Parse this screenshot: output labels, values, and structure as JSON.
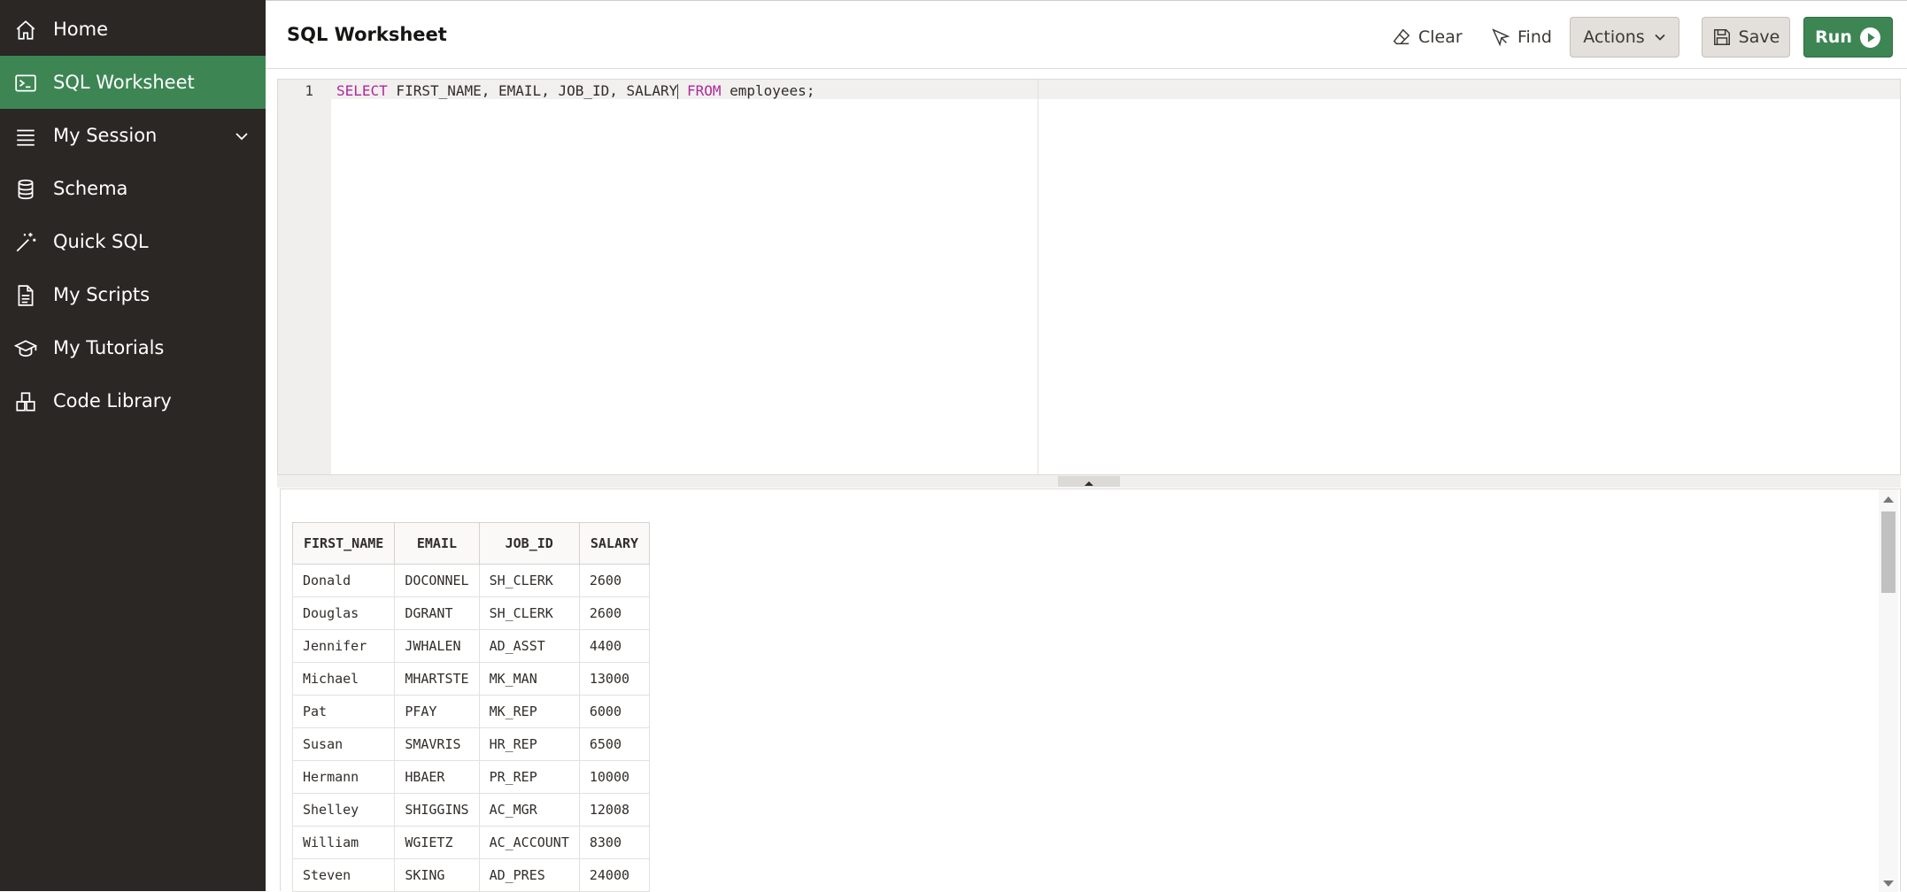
{
  "sidebar": {
    "items": [
      {
        "label": "Home",
        "icon": "home-icon"
      },
      {
        "label": "SQL Worksheet",
        "icon": "terminal-icon",
        "active": true
      },
      {
        "label": "My Session",
        "icon": "list-icon",
        "expandable": true
      },
      {
        "label": "Schema",
        "icon": "database-icon"
      },
      {
        "label": "Quick SQL",
        "icon": "magic-wand-icon"
      },
      {
        "label": "My Scripts",
        "icon": "document-icon"
      },
      {
        "label": "My Tutorials",
        "icon": "graduation-cap-icon"
      },
      {
        "label": "Code Library",
        "icon": "blocks-icon"
      }
    ],
    "active_color": "#3d8654",
    "background": "#2a2724"
  },
  "header": {
    "title": "SQL Worksheet",
    "toolbar": {
      "clear_label": "Clear",
      "find_label": "Find",
      "actions_label": "Actions",
      "save_label": "Save",
      "run_label": "Run"
    }
  },
  "editor": {
    "line_number": "1",
    "tokens": {
      "select_kw": "SELECT",
      "columns": " FIRST_NAME, EMAIL, JOB_ID, SALARY",
      "from_kw": "FROM",
      "rest": " employees;"
    },
    "keyword_color": "#b0289c"
  },
  "results": {
    "columns": [
      "FIRST_NAME",
      "EMAIL",
      "JOB_ID",
      "SALARY"
    ],
    "rows": [
      [
        "Donald",
        "DOCONNEL",
        "SH_CLERK",
        "2600"
      ],
      [
        "Douglas",
        "DGRANT",
        "SH_CLERK",
        "2600"
      ],
      [
        "Jennifer",
        "JWHALEN",
        "AD_ASST",
        "4400"
      ],
      [
        "Michael",
        "MHARTSTE",
        "MK_MAN",
        "13000"
      ],
      [
        "Pat",
        "PFAY",
        "MK_REP",
        "6000"
      ],
      [
        "Susan",
        "SMAVRIS",
        "HR_REP",
        "6500"
      ],
      [
        "Hermann",
        "HBAER",
        "PR_REP",
        "10000"
      ],
      [
        "Shelley",
        "SHIGGINS",
        "AC_MGR",
        "12008"
      ],
      [
        "William",
        "WGIETZ",
        "AC_ACCOUNT",
        "8300"
      ],
      [
        "Steven",
        "SKING",
        "AD_PRES",
        "24000"
      ]
    ]
  }
}
